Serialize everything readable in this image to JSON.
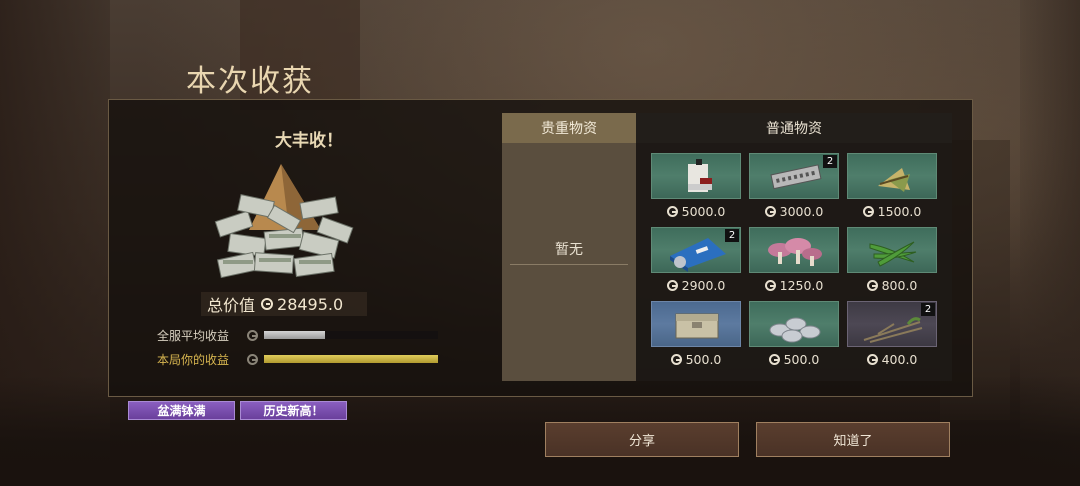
{
  "title": "本次收获",
  "summary": {
    "harvest_label": "大丰收！",
    "total_label": "总价值",
    "total_value": "28495.0",
    "avg_label": "全服平均收益",
    "avg_fraction": 0.35,
    "mine_label": "本局你的收益",
    "mine_fraction": 1.0
  },
  "tabs": {
    "precious": "贵重物资",
    "common": "普通物资"
  },
  "precious_empty": "暂无",
  "items": [
    {
      "icon": "fuel-can-icon",
      "price": "5000.0",
      "count": "",
      "rarity": "green"
    },
    {
      "icon": "harmonica-icon",
      "price": "3000.0",
      "count": "2",
      "rarity": "green"
    },
    {
      "icon": "rice-dumpling-icon",
      "price": "1500.0",
      "count": "",
      "rarity": "green"
    },
    {
      "icon": "blue-package-icon",
      "price": "2900.0",
      "count": "2",
      "rarity": "green"
    },
    {
      "icon": "mushroom-icon",
      "price": "1250.0",
      "count": "",
      "rarity": "green"
    },
    {
      "icon": "green-beans-icon",
      "price": "800.0",
      "count": "",
      "rarity": "green"
    },
    {
      "icon": "metal-box-icon",
      "price": "500.0",
      "count": "",
      "rarity": "blue"
    },
    {
      "icon": "coins-icon",
      "price": "500.0",
      "count": "",
      "rarity": "green"
    },
    {
      "icon": "twigs-icon",
      "price": "400.0",
      "count": "2",
      "rarity": "purple"
    }
  ],
  "achievements": [
    "盆满钵满",
    "历史新高！"
  ],
  "buttons": {
    "share": "分享",
    "ok": "知道了"
  },
  "colors": {
    "title": "#e9d6b0",
    "mine_bar": "#d8b650",
    "slot_green": "#4f7e6b",
    "slot_blue": "#5d7aa0",
    "slot_purple": "#4d4854",
    "achievement": "#7a4fb0"
  }
}
